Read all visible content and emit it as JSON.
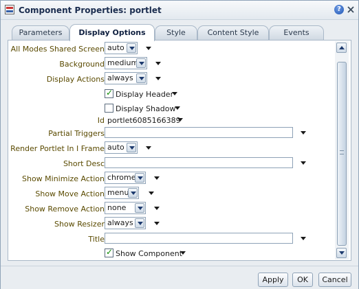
{
  "dialog": {
    "title": "Component Properties: portlet",
    "help_glyph": "?"
  },
  "tabs": [
    {
      "label": "Parameters"
    },
    {
      "label": "Display Options"
    },
    {
      "label": "Style"
    },
    {
      "label": "Content Style"
    },
    {
      "label": "Events"
    }
  ],
  "fields": {
    "all_modes": {
      "label": "All Modes Shared Screen",
      "value": "auto"
    },
    "background": {
      "label": "Background",
      "value": "medium"
    },
    "display_actions": {
      "label": "Display Actions",
      "value": "always"
    },
    "display_header": {
      "label": "Display Header",
      "checked": true
    },
    "display_shadow": {
      "label": "Display Shadow",
      "checked": false
    },
    "id": {
      "label": "Id",
      "value": "portlet6085166389"
    },
    "partial_triggers": {
      "label": "Partial Triggers",
      "value": ""
    },
    "render_iframe": {
      "label": "Render Portlet In I Frame",
      "value": "auto"
    },
    "short_desc": {
      "label": "Short Desc",
      "value": ""
    },
    "show_minimize": {
      "label": "Show Minimize Action",
      "value": "chrome"
    },
    "show_move": {
      "label": "Show Move Action",
      "value": "menu"
    },
    "show_remove": {
      "label": "Show Remove Action",
      "value": "none"
    },
    "show_resizer": {
      "label": "Show Resizer",
      "value": "always"
    },
    "title": {
      "label": "Title",
      "value": ""
    },
    "show_component": {
      "label": "Show Component",
      "checked": true
    }
  },
  "buttons": {
    "apply": "Apply",
    "ok": "OK",
    "cancel": "Cancel"
  },
  "colors": {
    "label_text": "#5a4a00",
    "check_mark": "#0a8a00",
    "accent": "#1d3a6e"
  }
}
